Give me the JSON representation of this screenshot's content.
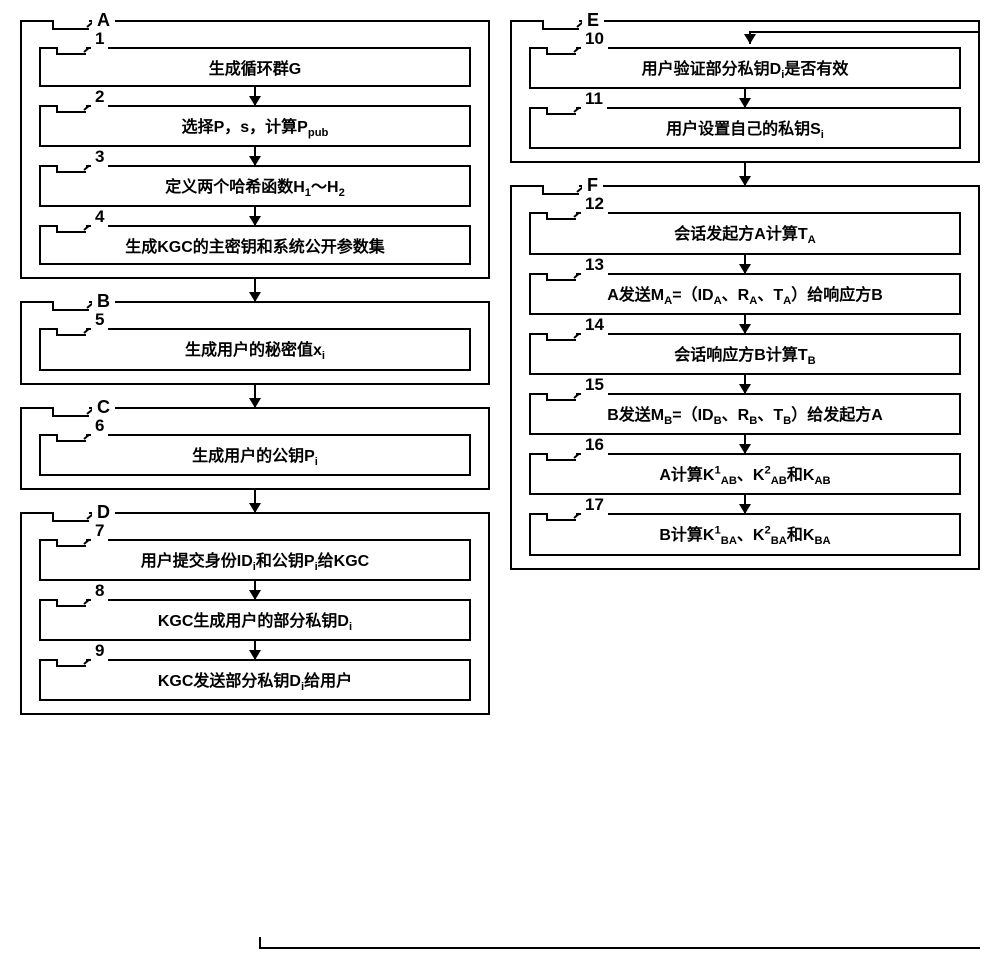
{
  "groups": {
    "A": {
      "label": "A"
    },
    "B": {
      "label": "B"
    },
    "C": {
      "label": "C"
    },
    "D": {
      "label": "D"
    },
    "E": {
      "label": "E"
    },
    "F": {
      "label": "F"
    }
  },
  "steps": {
    "1": {
      "num": "1",
      "text": "生成循环群G"
    },
    "2": {
      "num": "2",
      "html": "选择P，s，计算P<sub>pub</sub>"
    },
    "3": {
      "num": "3",
      "html": "定义两个哈希函数H<sub>1</sub>～H<sub>2</sub>"
    },
    "4": {
      "num": "4",
      "text": "生成KGC的主密钥和系统公开参数集"
    },
    "5": {
      "num": "5",
      "html": "生成用户的秘密值x<sub>i</sub>"
    },
    "6": {
      "num": "6",
      "html": "生成用户的公钥P<sub>i</sub>"
    },
    "7": {
      "num": "7",
      "html": "用户提交身份ID<sub>i</sub>和公钥P<sub>i</sub>给KGC"
    },
    "8": {
      "num": "8",
      "html": "KGC生成用户的部分私钥D<sub>i</sub>"
    },
    "9": {
      "num": "9",
      "html": "KGC发送部分私钥D<sub>i</sub>给用户"
    },
    "10": {
      "num": "10",
      "html": "用户验证部分私钥D<sub>i</sub>是否有效"
    },
    "11": {
      "num": "11",
      "html": "用户设置自己的私钥S<sub>i</sub>"
    },
    "12": {
      "num": "12",
      "html": "会话发起方A计算T<sub>A</sub>"
    },
    "13": {
      "num": "13",
      "html": "A发送M<sub>A</sub>=（ID<sub>A</sub>、R<sub>A</sub>、T<sub>A</sub>）给响应方B"
    },
    "14": {
      "num": "14",
      "html": "会话响应方B计算T<sub>B</sub>"
    },
    "15": {
      "num": "15",
      "html": "B发送M<sub>B</sub>=（ID<sub>B</sub>、R<sub>B</sub>、T<sub>B</sub>）给发起方A"
    },
    "16": {
      "num": "16",
      "html": "A计算K<sup>1</sup><sub>AB</sub>、K<sup>2</sup><sub>AB</sub>和K<sub>AB</sub>"
    },
    "17": {
      "num": "17",
      "html": "B计算K<sup>1</sup><sub>BA</sub>、K<sup>2</sup><sub>BA</sub>和K<sub>BA</sub>"
    }
  }
}
